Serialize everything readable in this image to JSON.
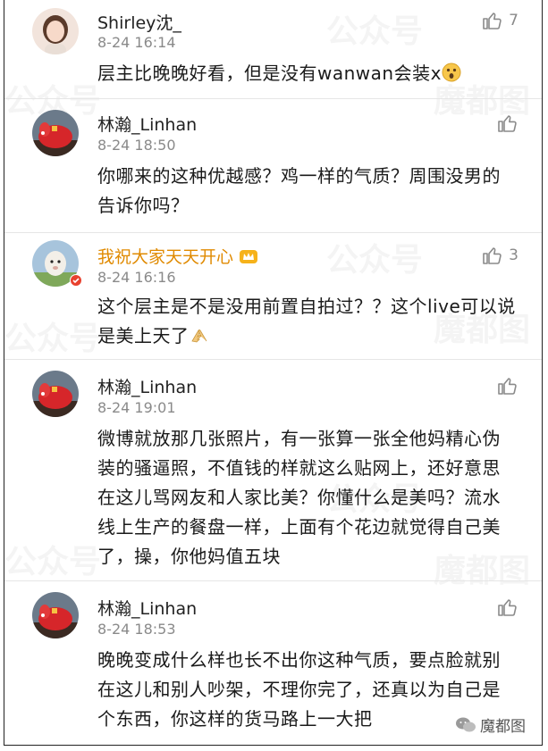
{
  "comments": [
    {
      "name": "Shirley沈_",
      "time": "8-24 16:14",
      "likes": "7",
      "text": "层主比晚晚好看，但是没有wanwan会装x",
      "avatar": "woman-photo"
    },
    {
      "name": "林瀚_Linhan",
      "time": "8-24 18:50",
      "likes": "",
      "text": "你哪来的这种优越感？鸡一样的气质？周围没男的告诉你吗？",
      "avatar": "red-pig"
    },
    {
      "name": "我祝大家天天开心",
      "time": "8-24 16:16",
      "likes": "3",
      "text": "这个层主是不是没用前置自拍过？？这个live可以说是美上天了",
      "avatar": "sheep-photo"
    },
    {
      "name": "林瀚_Linhan",
      "time": "8-24 19:01",
      "likes": "",
      "text": "微博就放那几张照片，有一张算一张全他妈精心伪装的骚逼照，不值钱的样就这么贴网上，还好意思在这儿骂网友和人家比美？你懂什么是美吗？流水线上生产的餐盘一样，上面有个花边就觉得自己美了，操，你他妈值五块",
      "avatar": "red-pig"
    },
    {
      "name": "林瀚_Linhan",
      "time": "8-24 18:53",
      "likes": "",
      "text": "晚晚变成什么样也长不出你这种气质，要点脸就别在这儿和别人吵架，不理你完了，还真以为自己是个东西，你这样的货马路上一大把",
      "avatar": "red-pig"
    }
  ],
  "watermark": {
    "text_a": "公众号",
    "text_b": "魔都图"
  },
  "logo": {
    "label": "魔都图"
  },
  "colors": {
    "vip_name": "#e08a00",
    "time": "#8a8a8a",
    "divider": "#e6e6e6"
  }
}
